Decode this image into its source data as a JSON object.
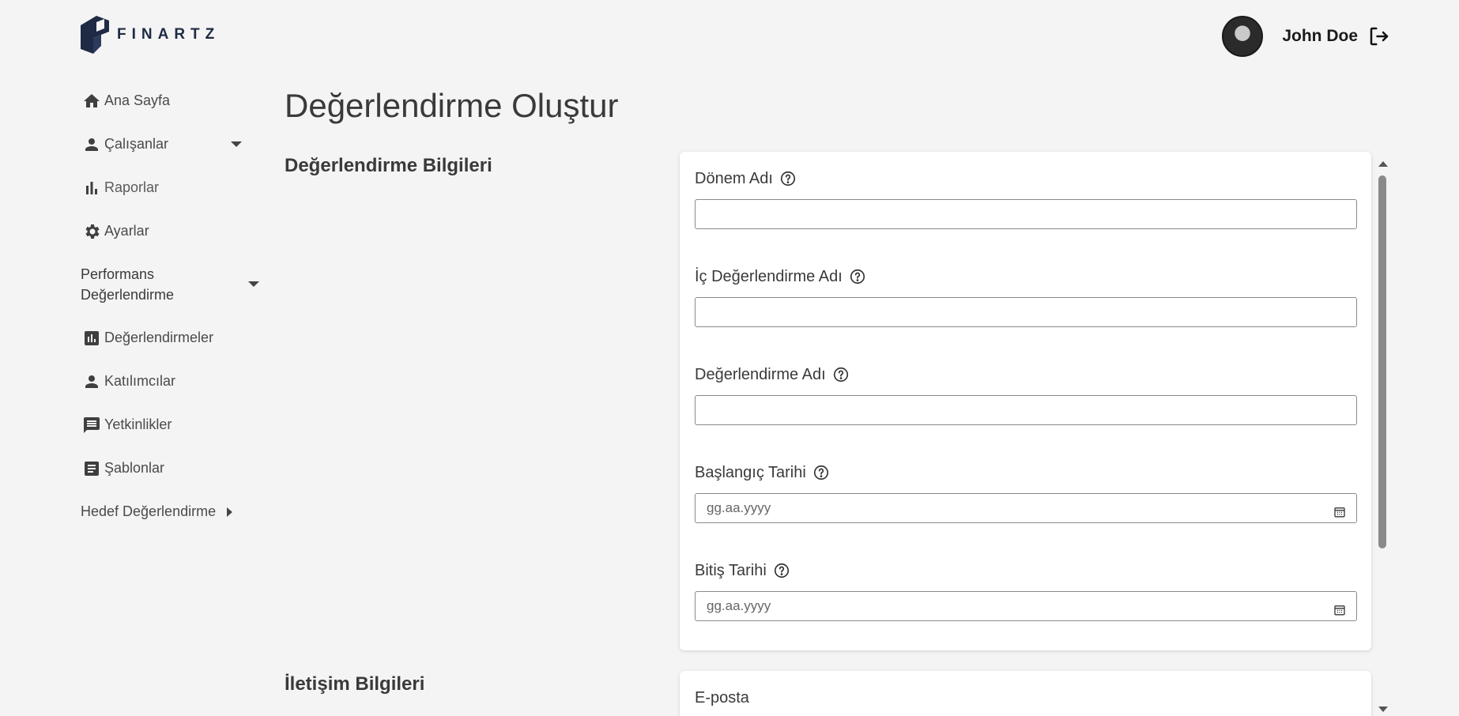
{
  "brand": {
    "name": "FINARTZ"
  },
  "user": {
    "name": "John Doe"
  },
  "sidebar": {
    "items": [
      {
        "label": "Ana Sayfa",
        "icon": "home-icon"
      },
      {
        "label": "Çalışanlar",
        "icon": "person-icon"
      },
      {
        "label": "Raporlar",
        "icon": "bar-chart-icon"
      },
      {
        "label": "Ayarlar",
        "icon": "gear-icon"
      }
    ],
    "group_performance": {
      "line1": "Performans",
      "line2": "Değerlendirme"
    },
    "sub_items": [
      {
        "label": "Değerlendirmeler",
        "icon": "chart-box-icon"
      },
      {
        "label": "Katılımcılar",
        "icon": "person-icon"
      },
      {
        "label": "Yetkinlikler",
        "icon": "message-icon"
      },
      {
        "label": "Şablonlar",
        "icon": "template-icon"
      }
    ],
    "group_target": {
      "label": "Hedef Değerlendirme"
    }
  },
  "main": {
    "title": "Değerlendirme Oluştur",
    "section1": {
      "title": "Değerlendirme Bilgileri",
      "fields": {
        "period_name": {
          "label": "Dönem Adı",
          "value": ""
        },
        "internal_name": {
          "label": "İç Değerlendirme Adı",
          "value": ""
        },
        "evaluation_name": {
          "label": "Değerlendirme Adı",
          "value": ""
        },
        "start_date": {
          "label": "Başlangıç Tarihi",
          "placeholder": "gg.aa.yyyy"
        },
        "end_date": {
          "label": "Bitiş Tarihi",
          "placeholder": "gg.aa.yyyy"
        }
      }
    },
    "section2": {
      "title": "İletişim Bilgileri",
      "fields": {
        "email": {
          "label": "E-posta"
        }
      }
    }
  },
  "colors": {
    "background": "#f4f4f4",
    "card": "#ffffff",
    "brand": "#1f2a44"
  }
}
